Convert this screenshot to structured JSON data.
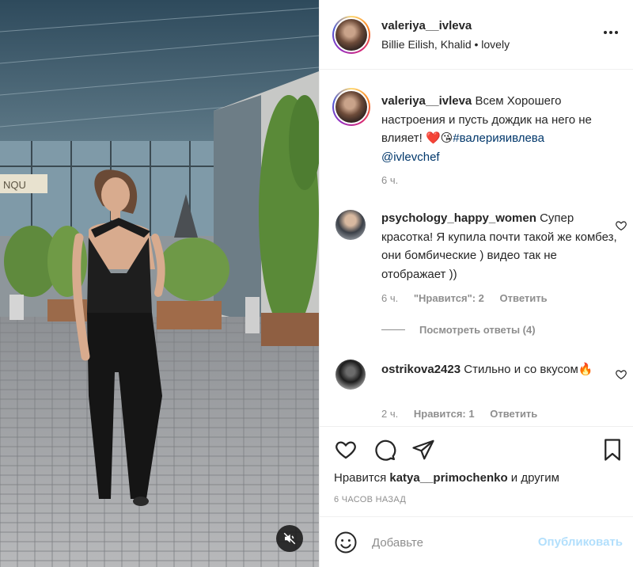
{
  "post": {
    "username": "valeriya__ivleva",
    "audio": "Billie Eilish, Khalid • lovely",
    "more_icon": "more-horizontal-icon"
  },
  "media": {
    "sign_text": "NQU",
    "mute_icon": "sound-off-icon"
  },
  "caption": {
    "username": "valeriya__ivleva",
    "text": "Всем Хорошего настроения и пусть дождик на него не влияет!",
    "emoji": "❤️😘",
    "hashtag": "#валерияивлева",
    "mention": "@ivlevchef",
    "time": "6 ч."
  },
  "comments": [
    {
      "username": "psychology_happy_women",
      "text": "Супер красотка! Я купила почти такой же комбез, они бомбические ) видео так не отображает ))",
      "time": "6 ч.",
      "likes": "\"Нравится\": 2",
      "reply": "Ответить",
      "view_replies": "Посмотреть ответы (4)"
    },
    {
      "username": "ostrikova2423",
      "text": "Стильно и со вкусом🔥",
      "time": "2 ч.",
      "likes": "Нравится: 1",
      "reply": "Ответить"
    }
  ],
  "actions": {
    "icons": [
      "heart-icon",
      "comment-icon",
      "share-icon",
      "bookmark-icon"
    ],
    "likes_prefix": "Нравится",
    "likes_user": "katya__primochenko",
    "likes_suffix": "и другим",
    "time_ago": "6 ЧАСОВ НАЗАД"
  },
  "add_comment": {
    "placeholder": "Добавьте",
    "publish": "Опубликовать"
  }
}
